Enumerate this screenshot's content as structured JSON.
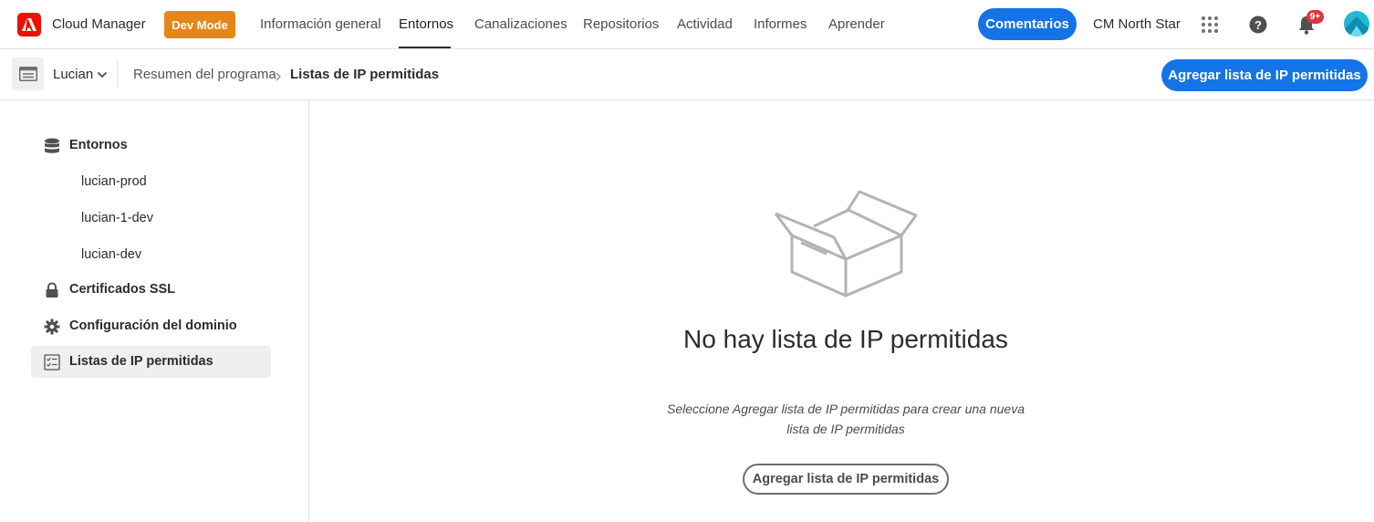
{
  "app": {
    "name": "Cloud Manager",
    "dev_mode": "Dev Mode"
  },
  "nav": {
    "tabs": [
      {
        "label": "Información general"
      },
      {
        "label": "Entornos",
        "active": true
      },
      {
        "label": "Canalizaciones"
      },
      {
        "label": "Repositorios"
      },
      {
        "label": "Actividad"
      },
      {
        "label": "Informes"
      },
      {
        "label": "Aprender"
      }
    ]
  },
  "header": {
    "feedback_label": "Comentarios",
    "org_name": "CM North Star",
    "notification_count": "9+",
    "icons": [
      "apps-grid-icon",
      "help-icon",
      "bell-icon",
      "avatar"
    ]
  },
  "subheader": {
    "program_name": "Lucian",
    "breadcrumb": {
      "parent": "Resumen del programa",
      "current": "Listas de IP permitidas"
    },
    "add_button_label": "Agregar lista de IP permitidas"
  },
  "sidebar": {
    "environments_label": "Entornos",
    "environments": [
      "lucian-prod",
      "lucian-1-dev",
      "lucian-dev"
    ],
    "ssl_label": "Certificados SSL",
    "domain_label": "Configuración del dominio",
    "ip_lists_label": "Listas de IP permitidas"
  },
  "empty_state": {
    "title": "No hay lista de IP permitidas",
    "description": "Seleccione Agregar lista de IP permitidas para crear una nueva lista de IP permitidas",
    "button_label": "Agregar lista de IP permitidas"
  },
  "colors": {
    "primary": "#1473e6",
    "adobe_red": "#eb1000",
    "dev_mode": "#e68619",
    "badge": "#d7373f"
  }
}
